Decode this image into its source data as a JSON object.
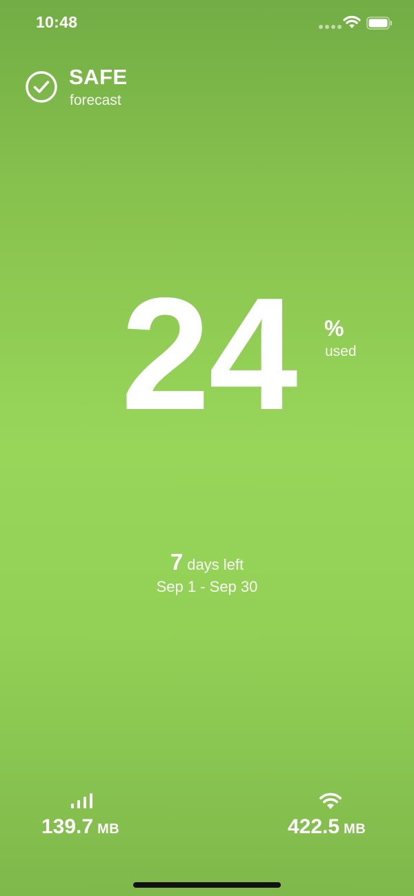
{
  "status_bar": {
    "time": "10:48"
  },
  "forecast": {
    "status": "SAFE",
    "label": "forecast",
    "icon": "checkmark-circle-icon"
  },
  "usage": {
    "value": "24",
    "unit": "%",
    "caption": "used"
  },
  "period": {
    "days_left": "7",
    "days_left_label": "days left",
    "range": "Sep 1 - Sep 30"
  },
  "stats": {
    "cellular": {
      "icon": "cellular-signal-icon",
      "value": "139.7",
      "unit": "MB"
    },
    "wifi": {
      "icon": "wifi-icon",
      "value": "422.5",
      "unit": "MB"
    }
  },
  "colors": {
    "background_top": "#72ad45",
    "background_mid": "#98d65a",
    "background_bottom": "#7fb84b",
    "text": "#ffffff"
  }
}
